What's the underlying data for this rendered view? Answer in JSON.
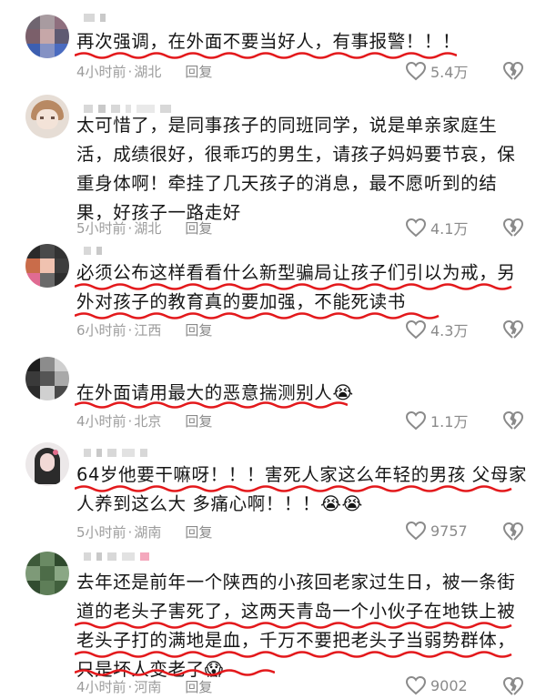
{
  "comments": [
    {
      "text": "再次强调，在外面不要当好人，有事报警！！！",
      "time": "4小时前",
      "location": "湖北",
      "reply": "回复",
      "likes": "5.4万"
    },
    {
      "text": "太可惜了，是同事孩子的同班同学，说是单亲家庭生活，成绩很好，很乖巧的男生，请孩子妈妈要节哀，保重身体啊！牵挂了几天孩子的消息，最不愿听到的结果，好孩子一路走好",
      "time": "5小时前",
      "location": "湖北",
      "reply": "回复",
      "likes": "4.1万"
    },
    {
      "text": "必须公布这样看看什么新型骗局让孩子们引以为戒，另外对孩子的教育真的要加强，不能死读书",
      "time": "6小时前",
      "location": "江西",
      "reply": "回复",
      "likes": "4.3万"
    },
    {
      "text": "在外面请用最大的恶意揣测别人😭",
      "time": "4小时前",
      "location": "北京",
      "reply": "回复",
      "likes": "1.1万"
    },
    {
      "text": "64岁他要干嘛呀！！！害死人家这么年轻的男孩 父母家人养到这么大 多痛心啊！！！😭😭",
      "time": "5小时前",
      "location": "湖南",
      "reply": "回复",
      "likes": "9757"
    },
    {
      "text": "去年还是前年一个陕西的小孩回老家过生日，被一条街道的老头子害死了，这两天青岛一个小伙子在地铁上被老头子打的满地是血，千万不要把老头子当弱势群体，只是坏人变老了😱",
      "time": "4小时前",
      "location": "河南",
      "reply": "回复",
      "likes": "9002"
    }
  ],
  "icons": {
    "like": "heart-outline-icon",
    "dislike": "broken-heart-icon"
  },
  "colors": {
    "underline": "#e3191c",
    "meta": "#9c9c9c"
  }
}
